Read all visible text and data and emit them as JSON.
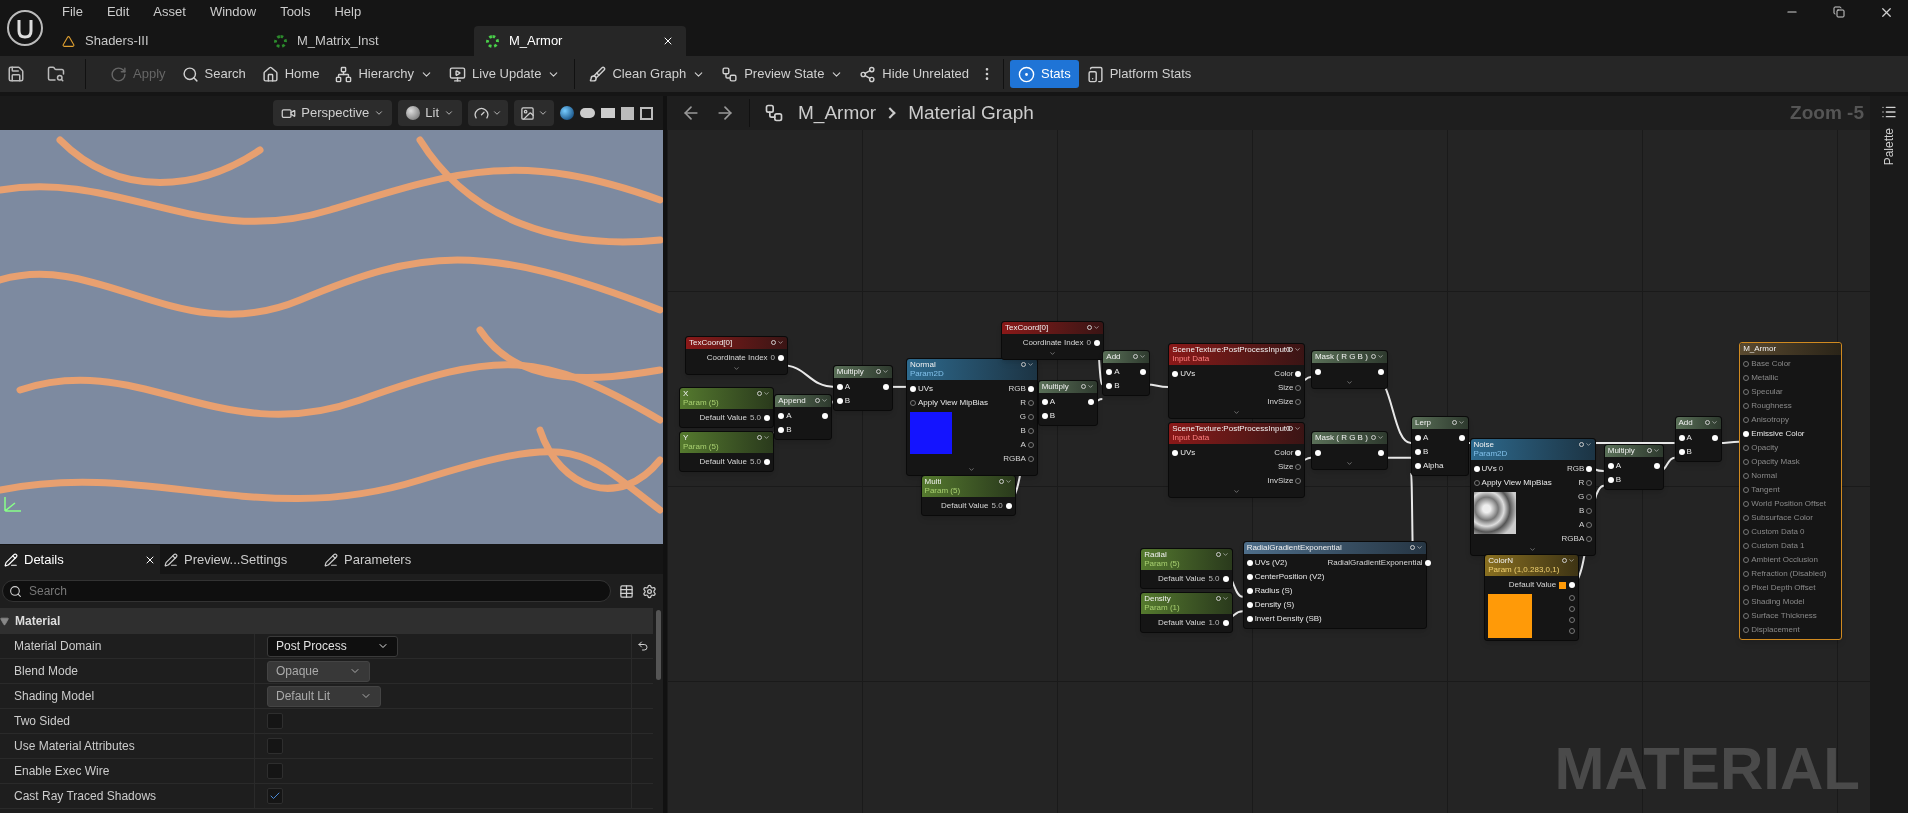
{
  "menu": [
    "File",
    "Edit",
    "Asset",
    "Window",
    "Tools",
    "Help"
  ],
  "tabs": [
    {
      "label": "Shaders-III",
      "kind": "shader",
      "selected": false
    },
    {
      "label": "M_Matrix_Inst",
      "kind": "instance",
      "selected": false
    },
    {
      "label": "M_Armor",
      "kind": "material",
      "selected": true
    }
  ],
  "toolbar": [
    {
      "label": "Apply",
      "kind": "apply",
      "disabled": true,
      "dropdown": false,
      "selected": false
    },
    {
      "label": "Search",
      "kind": "search",
      "disabled": false,
      "dropdown": false,
      "selected": false
    },
    {
      "label": "Home",
      "kind": "home",
      "disabled": false,
      "dropdown": false,
      "selected": false
    },
    {
      "label": "Hierarchy",
      "kind": "hierarchy",
      "disabled": false,
      "dropdown": true,
      "selected": false
    },
    {
      "label": "Live Update",
      "kind": "live",
      "disabled": false,
      "dropdown": true,
      "selected": false
    },
    {
      "label": "Clean Graph",
      "kind": "clean",
      "disabled": false,
      "dropdown": true,
      "selected": false
    },
    {
      "label": "Preview State",
      "kind": "preview",
      "disabled": false,
      "dropdown": true,
      "selected": false
    },
    {
      "label": "Hide Unrelated",
      "kind": "hide",
      "disabled": false,
      "dropdown": false,
      "selected": false
    },
    {
      "label": "Stats",
      "kind": "stats",
      "disabled": false,
      "dropdown": false,
      "selected": true
    },
    {
      "label": "Platform Stats",
      "kind": "platform",
      "disabled": false,
      "dropdown": false,
      "selected": false
    }
  ],
  "viewport": {
    "view_mode": "Perspective",
    "lighting": "Lit"
  },
  "details": {
    "tabs": [
      {
        "label": "Details",
        "selected": true
      },
      {
        "label": "Preview...Settings",
        "selected": false
      },
      {
        "label": "Parameters",
        "selected": false
      }
    ],
    "search": {
      "placeholder": "Search"
    },
    "section": {
      "label": "Material",
      "expanded": true
    },
    "properties": [
      {
        "label": "Material Domain",
        "kind": "dropdown",
        "value": "Post Process",
        "disabled": false,
        "resettable": true
      },
      {
        "label": "Blend Mode",
        "kind": "dropdown",
        "value": "Opaque",
        "disabled": true,
        "resettable": false
      },
      {
        "label": "Shading Model",
        "kind": "dropdown",
        "value": "Default Lit",
        "disabled": true,
        "resettable": false
      },
      {
        "label": "Two Sided",
        "kind": "checkbox",
        "checked": false
      },
      {
        "label": "Use Material Attributes",
        "kind": "checkbox",
        "checked": false
      },
      {
        "label": "Enable Exec Wire",
        "kind": "checkbox",
        "checked": false
      },
      {
        "label": "Cast Ray Traced Shadows",
        "kind": "checkbox",
        "checked": true
      }
    ]
  },
  "graph": {
    "breadcrumb": [
      "M_Armor",
      "Material Graph"
    ],
    "zoom": "Zoom -5",
    "watermark": "MATERIAL",
    "palette": "Palette",
    "nodes": [
      {
        "kind": "texcoord",
        "title": "TexCoord[0]",
        "value_rows": [
          {
            "label": "Coordinate Index",
            "value": "0"
          }
        ],
        "expandable": true
      },
      {
        "kind": "param",
        "title": "X",
        "subtitle": "Param (5)",
        "value_rows": [
          {
            "label": "Default Value",
            "value": "5.0"
          }
        ],
        "expandable": false
      },
      {
        "kind": "param",
        "title": "Y",
        "subtitle": "Param (5)",
        "value_rows": [
          {
            "label": "Default Value",
            "value": "5.0"
          }
        ],
        "expandable": false
      },
      {
        "kind": "math",
        "title": "Append",
        "inputs": [
          {
            "label": "A"
          },
          {
            "label": "B"
          }
        ],
        "expandable": false
      },
      {
        "kind": "math",
        "title": "Multiply",
        "inputs": [
          {
            "label": "A"
          },
          {
            "label": "B"
          }
        ],
        "expandable": false
      },
      {
        "kind": "texture",
        "title": "Normal",
        "subtitle": "Param2D",
        "preview": {
          "kind": "normal"
        },
        "inputs": [
          {
            "label": "UVs"
          },
          {
            "label": "Apply View MipBias"
          }
        ],
        "outputs": [
          "RGB",
          "R",
          "G",
          "B",
          "A",
          "RGBA"
        ],
        "expandable": true
      },
      {
        "kind": "param",
        "title": "Multi",
        "subtitle": "Param (5)",
        "value_rows": [
          {
            "label": "Default Value",
            "value": "5.0"
          }
        ],
        "expandable": false
      },
      {
        "kind": "texcoord",
        "title": "TexCoord[0]",
        "value_rows": [
          {
            "label": "Coordinate Index",
            "value": "0"
          }
        ],
        "expandable": true
      },
      {
        "kind": "math",
        "title": "Multiply",
        "inputs": [
          {
            "label": "A"
          },
          {
            "label": "B"
          }
        ],
        "expandable": false
      },
      {
        "kind": "math",
        "title": "Add",
        "inputs": [
          {
            "label": "A"
          },
          {
            "label": "B"
          }
        ],
        "expandable": false
      },
      {
        "kind": "scene",
        "title": "SceneTexture:PostProcessInput0",
        "subtitle": "Input Data",
        "inputs": [
          {
            "label": "UVs"
          }
        ],
        "outputs": [
          "Color",
          "Size",
          "InvSize"
        ],
        "expandable": true
      },
      {
        "kind": "scene",
        "title": "SceneTexture:PostProcessInput0",
        "subtitle": "Input Data",
        "inputs": [
          {
            "label": "UVs"
          }
        ],
        "outputs": [
          "Color",
          "Size",
          "InvSize"
        ],
        "expandable": true
      },
      {
        "kind": "math",
        "title": "Mask ( R G B )",
        "expandable": true
      },
      {
        "kind": "math",
        "title": "Mask ( R G B )",
        "expandable": true
      },
      {
        "kind": "math",
        "title": "Lerp",
        "inputs": [
          {
            "label": "A"
          },
          {
            "label": "B"
          },
          {
            "label": "Alpha"
          }
        ],
        "expandable": false
      },
      {
        "kind": "texture",
        "title": "Noise",
        "subtitle": "Param2D",
        "preview": {
          "kind": "noise"
        },
        "inputs": [
          {
            "label": "UVs",
            "value": "0"
          },
          {
            "label": "Apply View MipBias"
          }
        ],
        "outputs": [
          "RGB",
          "R",
          "G",
          "B",
          "A",
          "RGBA"
        ],
        "expandable": true
      },
      {
        "kind": "color",
        "title": "ColorN",
        "subtitle": "Param (1,0.283,0,1)",
        "preview": {
          "kind": "swatch"
        },
        "value_rows": [
          {
            "label": "Default Value"
          }
        ],
        "expandable": false
      },
      {
        "kind": "math",
        "title": "Multiply",
        "inputs": [
          {
            "label": "A"
          },
          {
            "label": "B"
          }
        ],
        "expandable": false
      },
      {
        "kind": "math",
        "title": "Add",
        "inputs": [
          {
            "label": "A"
          },
          {
            "label": "B"
          }
        ],
        "expandable": false
      },
      {
        "kind": "result",
        "title": "M_Armor",
        "inputs": [
          {
            "label": "Base Color",
            "disabled": true
          },
          {
            "label": "Metallic",
            "disabled": true
          },
          {
            "label": "Specular",
            "disabled": true
          },
          {
            "label": "Roughness",
            "disabled": true
          },
          {
            "label": "Anisotropy",
            "disabled": true
          },
          {
            "label": "Emissive Color",
            "disabled": false
          },
          {
            "label": "Opacity",
            "disabled": true
          },
          {
            "label": "Opacity Mask",
            "disabled": true
          },
          {
            "label": "Normal",
            "disabled": true
          },
          {
            "label": "Tangent",
            "disabled": true
          },
          {
            "label": "World Position Offset",
            "disabled": true
          },
          {
            "label": "Subsurface Color",
            "disabled": true
          },
          {
            "label": "Custom Data 0",
            "disabled": true
          },
          {
            "label": "Custom Data 1",
            "disabled": true
          },
          {
            "label": "Ambient Occlusion",
            "disabled": true
          },
          {
            "label": "Refraction (Disabled)",
            "disabled": true
          },
          {
            "label": "Pixel Depth Offset",
            "disabled": true
          },
          {
            "label": "Shading Model",
            "disabled": true
          },
          {
            "label": "Surface Thickness",
            "disabled": true
          },
          {
            "label": "Displacement",
            "disabled": true
          }
        ],
        "expandable": false
      },
      {
        "kind": "param",
        "title": "Radial",
        "subtitle": "Param (5)",
        "value_rows": [
          {
            "label": "Default Value",
            "value": "5.0"
          }
        ],
        "expandable": false
      },
      {
        "kind": "param",
        "title": "Density",
        "subtitle": "Param (1)",
        "value_rows": [
          {
            "label": "Default Value",
            "value": "1.0"
          }
        ],
        "expandable": false
      },
      {
        "kind": "custom",
        "title": "RadialGradientExponential",
        "inputs": [
          {
            "label": "UVs (V2)"
          },
          {
            "label": "CenterPosition (V2)"
          },
          {
            "label": "Radius (S)"
          },
          {
            "label": "Density (S)"
          },
          {
            "label": "Invert Density (SB)"
          }
        ],
        "outputs": [
          "RadialGradientExponential"
        ],
        "expandable": false
      }
    ]
  }
}
